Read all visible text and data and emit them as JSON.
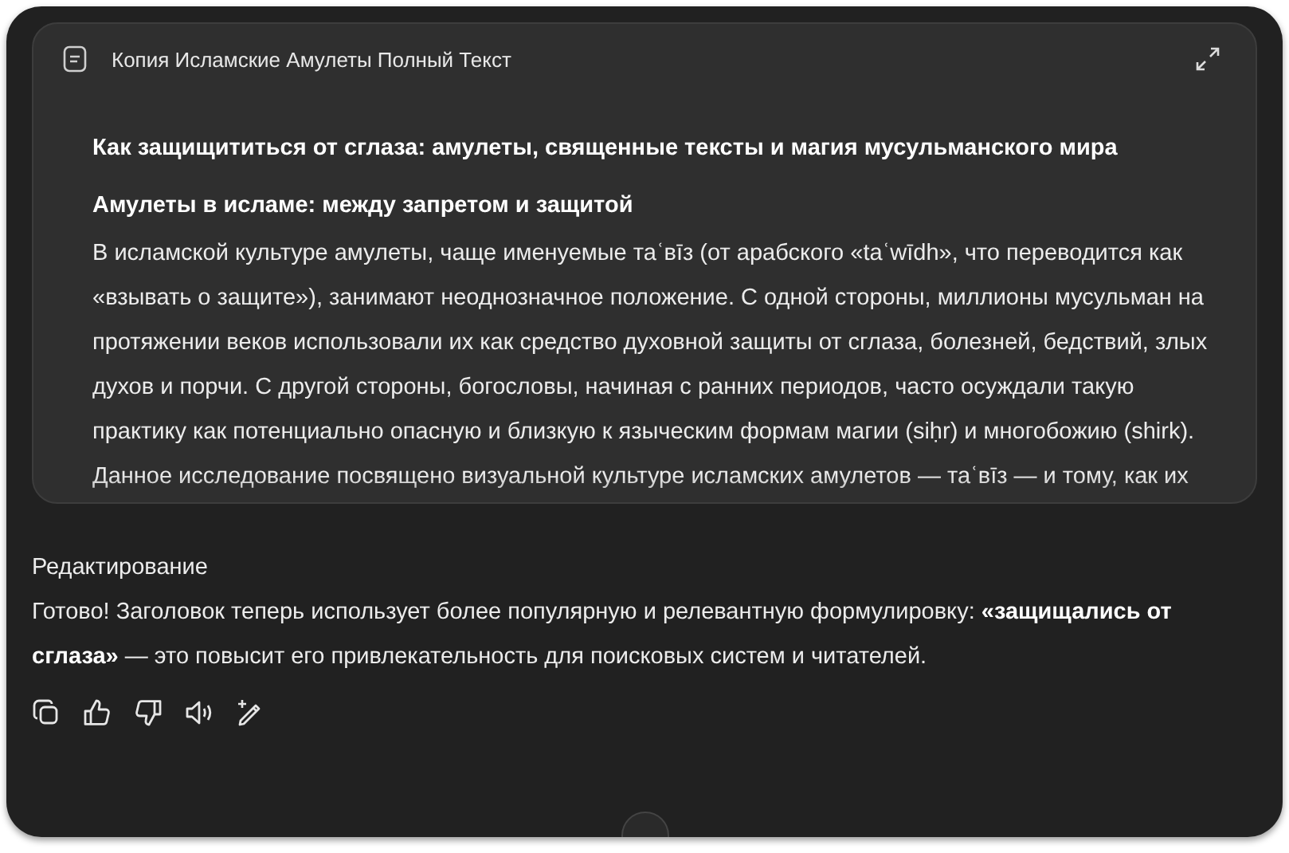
{
  "document_card": {
    "title": "Копия Исламские Амулеты Полный Текст",
    "heading": "Как защищититься от сглаза: амулеты, священные тексты и магия мусульманского мира",
    "subheading": "Амулеты в исламе: между запретом и защитой",
    "paragraph": "В исламской культуре амулеты, чаще именуемые таʿвīз (от арабского «taʿwīdh», что переводится как «взывать о защите»), занимают неоднозначное положение. С одной стороны, миллионы мусульман на протяжении веков использовали их как средство духовной защиты от сглаза, болезней, бедствий, злых духов и порчи. С другой стороны, богословы, начиная с ранних периодов, часто осуждали такую практику как потенциально опасную и близкую к языческим формам магии (siḥr) и многобожию (shirk). Данное исследование посвящено визуальной культуре исламских амулетов — таʿвīз — и тому, как их"
  },
  "message": {
    "label": "Редактирование",
    "text": "Готово! Заголовок теперь использует более популярную и релевантную формулировку: **«защищались от сглаза»** — это повысит его привлекательность для поисковых систем и читателей."
  },
  "actions": [
    {
      "kind": "copy"
    },
    {
      "kind": "like"
    },
    {
      "kind": "dislike"
    },
    {
      "kind": "read-aloud"
    },
    {
      "kind": "edit"
    }
  ]
}
